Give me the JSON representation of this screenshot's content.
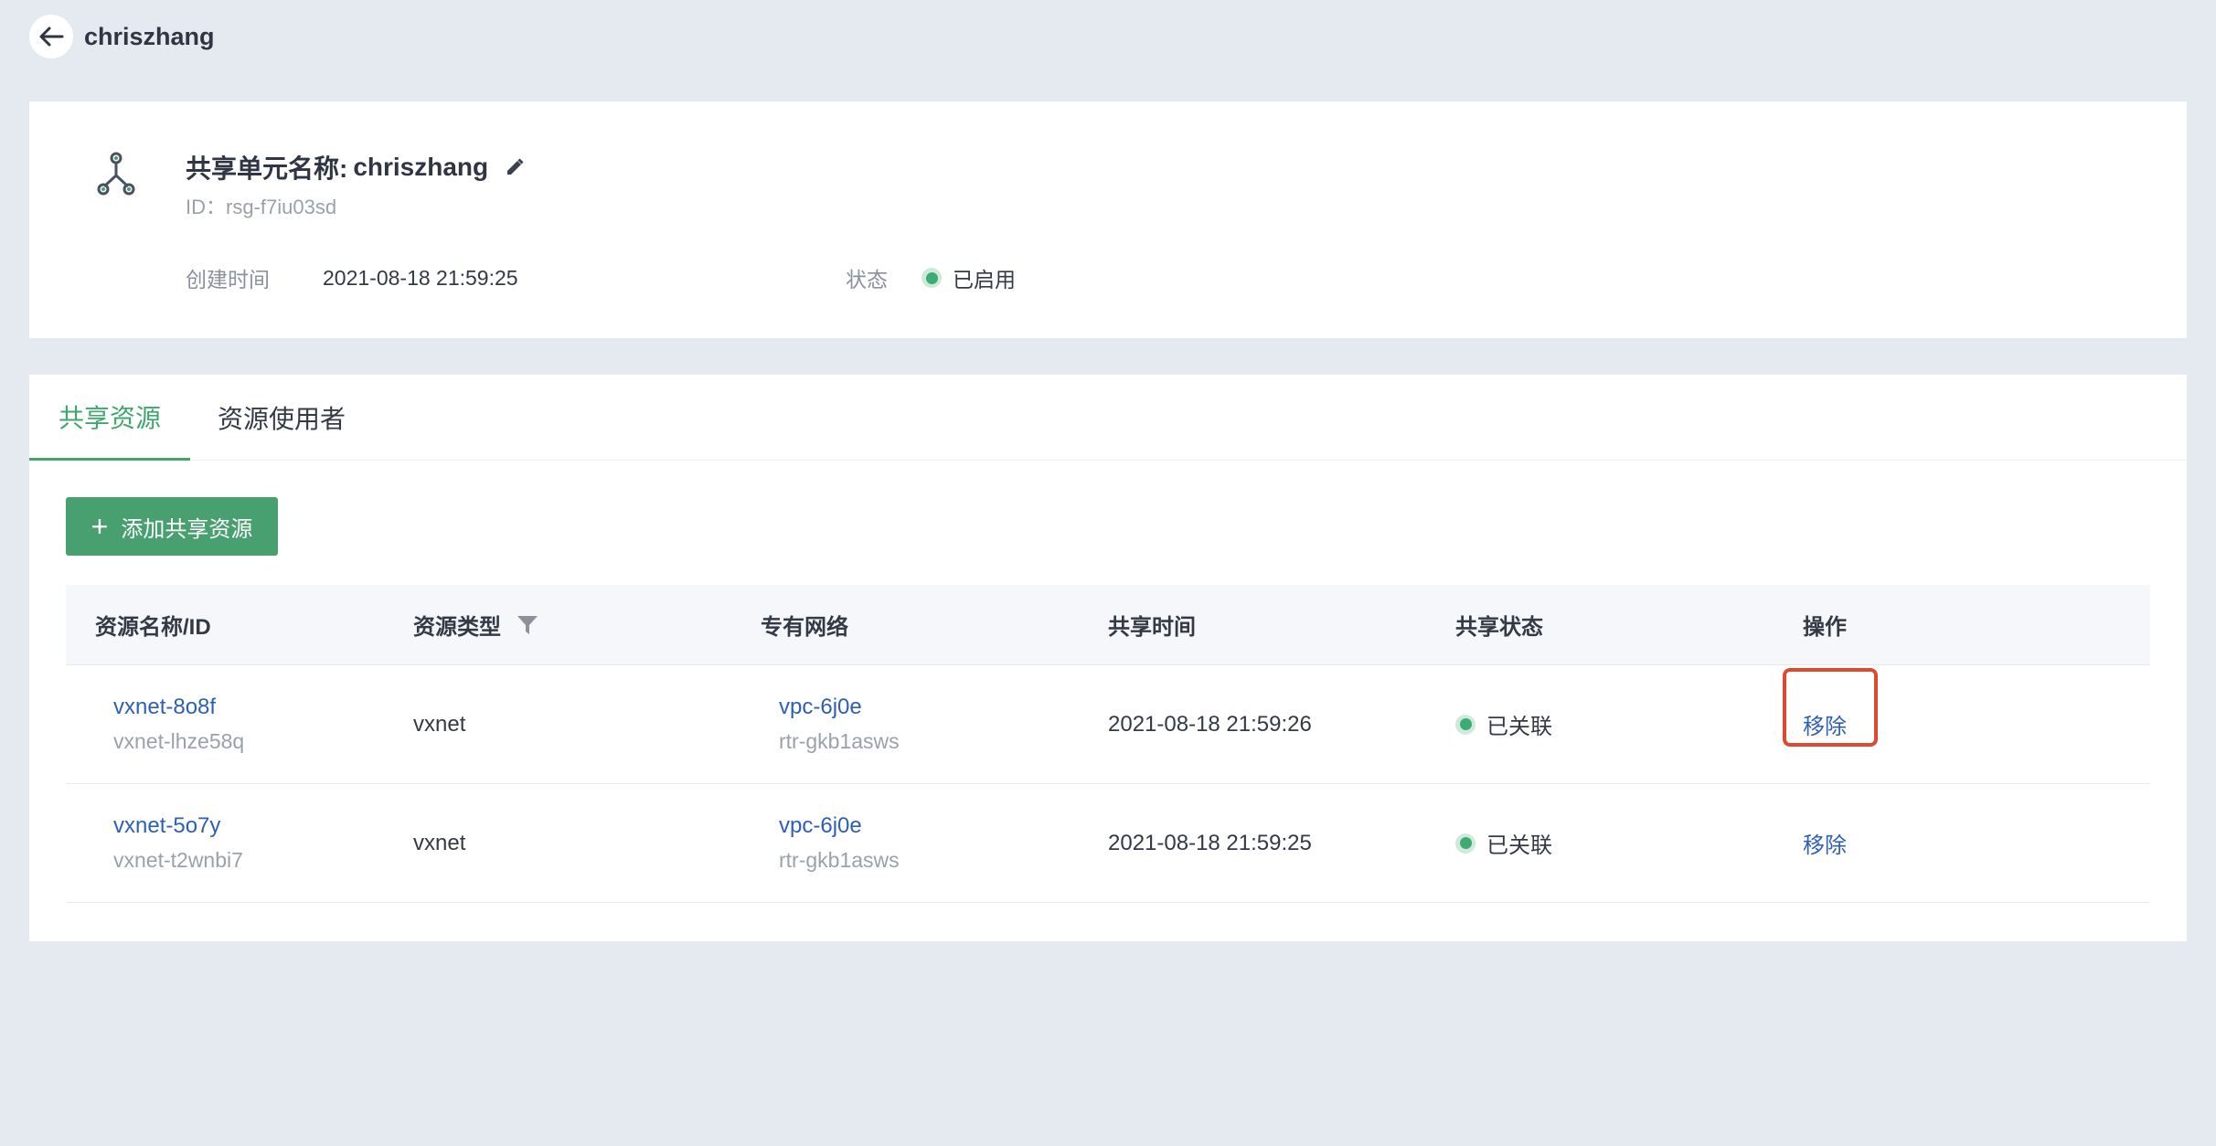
{
  "header": {
    "title": "chriszhang"
  },
  "unit": {
    "name_label": "共享单元名称:",
    "name_value": "chriszhang",
    "id_text": "ID：rsg-f7iu03sd",
    "created_label": "创建时间",
    "created_value": "2021-08-18 21:59:25",
    "status_label": "状态",
    "status_value": "已启用"
  },
  "tabs": [
    {
      "label": "共享资源"
    },
    {
      "label": "资源使用者"
    }
  ],
  "add_button": {
    "label": "添加共享资源"
  },
  "table": {
    "columns": [
      "资源名称/ID",
      "资源类型",
      "专有网络",
      "共享时间",
      "共享状态",
      "操作"
    ],
    "rows": [
      {
        "name": "vxnet-8o8f",
        "id": "vxnet-lhze58q",
        "type": "vxnet",
        "vpc": "vpc-6j0e",
        "vpc_sub": "rtr-gkb1asws",
        "time": "2021-08-18 21:59:26",
        "status": "已关联",
        "action": "移除"
      },
      {
        "name": "vxnet-5o7y",
        "id": "vxnet-t2wnbi7",
        "type": "vxnet",
        "vpc": "vpc-6j0e",
        "vpc_sub": "rtr-gkb1asws",
        "time": "2021-08-18 21:59:25",
        "status": "已关联",
        "action": "移除"
      }
    ]
  },
  "colors": {
    "accent_green": "#3fa66c",
    "button_green": "#48a071",
    "link_blue": "#2e5fb7",
    "highlight_red": "#de4a2f"
  }
}
